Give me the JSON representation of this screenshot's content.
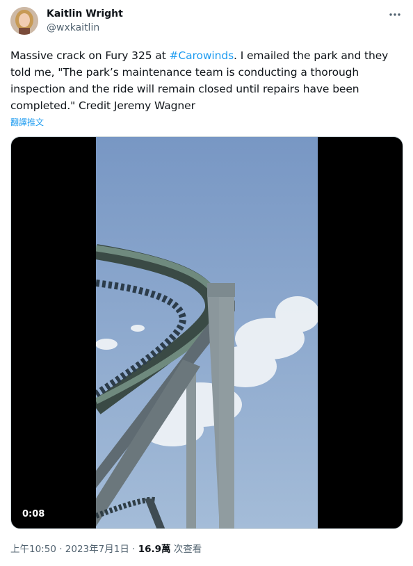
{
  "author": {
    "name": "Kaitlin Wright",
    "handle": "@wxkaitlin",
    "avatar_icon": "profile-photo"
  },
  "tweet": {
    "text_before": "Massive crack on Fury 325 at ",
    "hashtag": "#Carowinds",
    "text_after": ". I emailed the park and they told me, \"The park’s maintenance team is conducting a thorough inspection and the ride will remain closed until repairs have been completed.\" Credit Jeremy Wagner",
    "translate_label": "翻譯推文"
  },
  "media": {
    "duration": "0:08",
    "sky_color": "#7f9fc8"
  },
  "meta": {
    "time_date": "上午10:50 · 2023年7月1日 · ",
    "views_count": "16.9萬",
    "views_label": " 次查看"
  },
  "more_icon": "more-dots-icon"
}
